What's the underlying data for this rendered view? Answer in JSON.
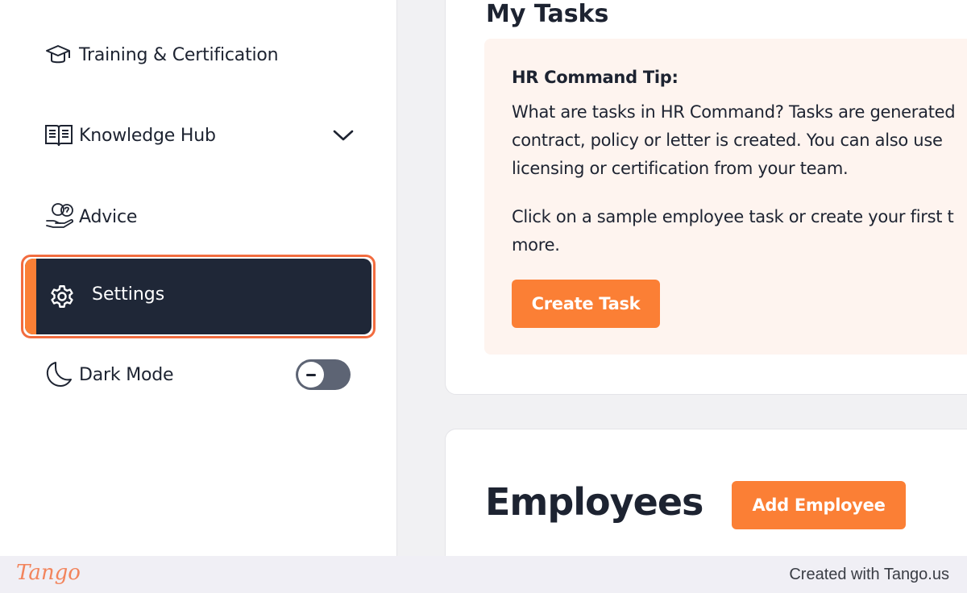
{
  "sidebar": {
    "items": [
      {
        "label": "Training & Certification",
        "icon": "graduation-cap-icon"
      },
      {
        "label": "Knowledge Hub",
        "icon": "book-icon"
      },
      {
        "label": "Advice",
        "icon": "advice-hand-icon"
      },
      {
        "label": "Settings",
        "icon": "gear-icon"
      },
      {
        "label": "Dark Mode",
        "icon": "moon-icon"
      }
    ],
    "dark_mode_enabled": false
  },
  "main": {
    "tasks_title": "My Tasks",
    "tip_heading": "HR Command Tip:",
    "tip_lines": [
      "What are tasks in HR Command? Tasks are generated",
      "contract, policy or letter is created. You can also use",
      "licensing or certification from your team."
    ],
    "tip_lines2": [
      "Click on a sample employee task or create your first t",
      "more."
    ],
    "create_task_label": "Create Task",
    "employees_title": "Employees",
    "add_employee_label": "Add Employee"
  },
  "footer": {
    "logo": "Tango",
    "text": "Created with Tango.us"
  },
  "colors": {
    "accent": "#fb7f35",
    "highlight": "#f26c3f",
    "nav_active_bg": "#1f2737",
    "tip_bg": "#fef4ef"
  }
}
